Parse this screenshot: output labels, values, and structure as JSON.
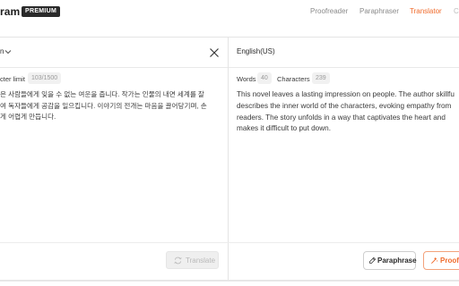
{
  "header": {
    "brand": "ram",
    "badge": "PREMIUM",
    "nav": [
      "Proofreader",
      "Paraphraser",
      "Translator"
    ],
    "active": "Translator",
    "accent": "#f06b2c"
  },
  "source": {
    "lang_label": "n",
    "limit_label": "cter limit",
    "count": "103/1500",
    "lines": [
      "은 사람들에게 잊을 수 없는 여운을 줍니다. 작가는 인물의 내면 세계를 잘",
      "여 독자들에게 공감을 일으킵니다. 이야기의 전개는 마음을 끌어당기며, 손",
      "게 어렵게 만듭니다."
    ],
    "translate_label": "Translate"
  },
  "target": {
    "lang_label": "English(US)",
    "words_label": "Words",
    "words": "40",
    "chars_label": "Characters",
    "chars": "239",
    "lines": [
      "This novel leaves a lasting impression on people. The author skillfu",
      "describes the inner world of the characters, evoking empathy from",
      "readers. The story unfolds in a way that captivates the heart and",
      "makes it difficult to put down."
    ],
    "paraphrase_label": "Paraphrase",
    "proofread_label": "Proofre"
  },
  "icons": {
    "chevron": "chevron-down-icon",
    "close": "close-icon",
    "translate": "translate-icon",
    "paraphrase": "paraphrase-icon",
    "proofread": "proofread-icon"
  }
}
